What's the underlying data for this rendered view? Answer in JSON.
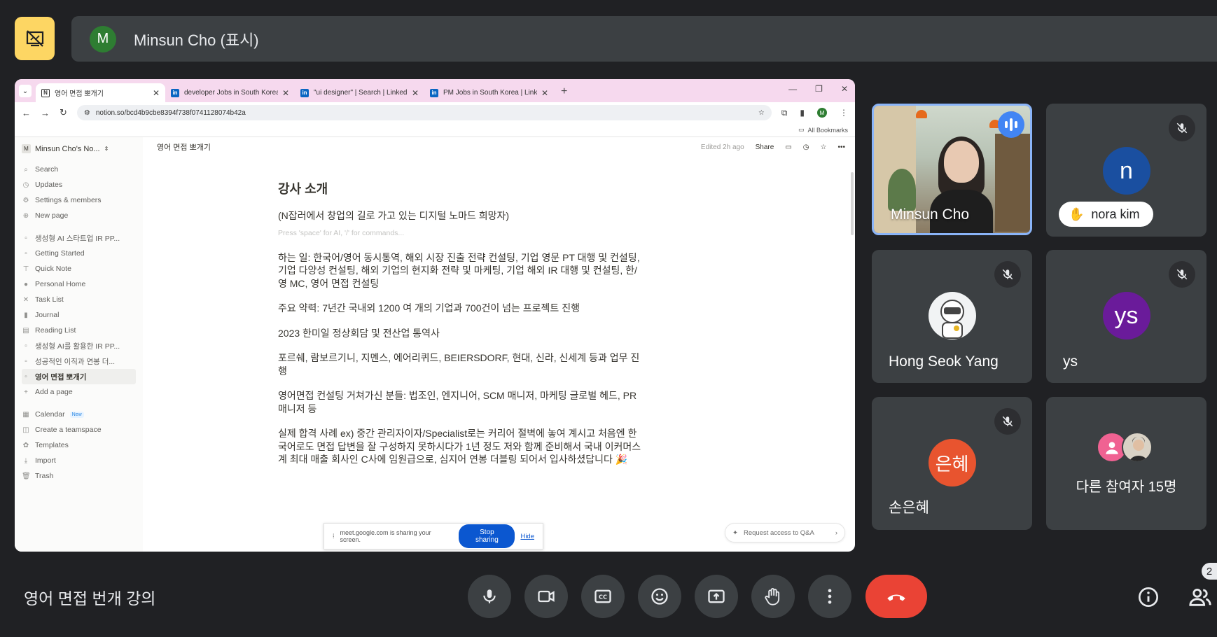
{
  "presenter": {
    "avatar_letter": "M",
    "name": "Minsun Cho (표시)"
  },
  "browser": {
    "tabs": [
      {
        "title": "영어 면접 뽀개기",
        "icon": "notion"
      },
      {
        "title": "developer Jobs in South Korea",
        "icon": "linkedin"
      },
      {
        "title": "\"ui designer\" | Search | LinkedIn",
        "icon": "linkedin"
      },
      {
        "title": "PM Jobs in South Korea | LinkedIn",
        "icon": "linkedin"
      }
    ],
    "url": "notion.so/bcd4b9cbe8394f738f0741128074b42a",
    "profile_letter": "M",
    "bookmarks_label": "All Bookmarks"
  },
  "notion": {
    "workspace": "Minsun Cho's No...",
    "workspace_letter": "M",
    "nav": [
      "Search",
      "Updates",
      "Settings & members",
      "New page"
    ],
    "pages": [
      "생성형 AI 스타트업 IR PP...",
      "Getting Started",
      "Quick Note",
      "Personal Home",
      "Task List",
      "Journal",
      "Reading List",
      "생성형 AI를 활용한 IR PP...",
      "성공적인 이직과 연봉 더...",
      "영어 면접 뽀개기",
      "Add a page"
    ],
    "bottom": [
      "Calendar",
      "Create a teamspace",
      "Templates",
      "Import",
      "Trash"
    ],
    "calendar_badge": "New",
    "breadcrumb": "영어 면접 뽀개기",
    "edited": "Edited 2h ago",
    "share": "Share",
    "heading": "강사 소개",
    "subtitle": "(N잡러에서 창업의 길로 가고 있는 디지털 노마드 희망자)",
    "placeholder": "Press 'space' for AI, '/' for commands...",
    "paragraphs": [
      "하는 일: 한국어/영어 동시통역, 해외 시장 진출 전략 컨설팅, 기업 영문 PT 대행 및 컨설팅, 기업 다양성 컨설팅, 해외 기업의 현지화 전략 및 마케팅, 기업 해외 IR 대행 및 컨설팅, 한/영 MC, 영어 면접 컨설팅",
      "주요 약력: 7년간 국내외 1200 여 개의 기업과 700건이 넘는 프로젝트 진행",
      "2023 한미일 정상회담 및 전산업 통역사",
      "포르쉐, 람보르기니, 지멘스, 에어리퀴드, BEIERSDORF, 현대, 신라, 신세계 등과 업무 진행",
      "영어면접 컨설팅 거쳐가신 분들: 법조인, 엔지니어, SCM 매니저, 마케팅 글로벌 헤드, PR 매니저 등",
      "실제 합격 사례 ex) 중간 관리자이자/Specialist로는 커리어 절벽에 놓여 계시고 처음엔 한국어로도 면접 답변을 잘 구성하지 못하시다가 1년 정도 저와 함께 준비해서 국내 이커머스계 최대 매출 회사인 C사에 임원급으로, 심지어 연봉 더블링 되어서 입사하셨답니다 🎉"
    ],
    "qa_label": "Request access to Q&A"
  },
  "share_bar": {
    "text": "meet.google.com is sharing your screen.",
    "stop": "Stop sharing",
    "hide": "Hide"
  },
  "participants": [
    {
      "name": "Minsun Cho",
      "type": "video",
      "speaking": true
    },
    {
      "name": "nora kim",
      "letter": "n",
      "color": "#1a4fa0",
      "hand_raised": true,
      "muted": true
    },
    {
      "name": "Hong Seok Yang",
      "type": "image",
      "muted": true
    },
    {
      "name": "ys",
      "letter": "ys",
      "color": "#6a1b9a",
      "muted": true
    },
    {
      "name": "손은혜",
      "letter": "은혜",
      "color": "#e8542f",
      "muted": true
    },
    {
      "name": "다른 참여자 15명",
      "type": "others"
    }
  ],
  "meeting_title": "영어 면접 번개 강의",
  "people_count": "2"
}
